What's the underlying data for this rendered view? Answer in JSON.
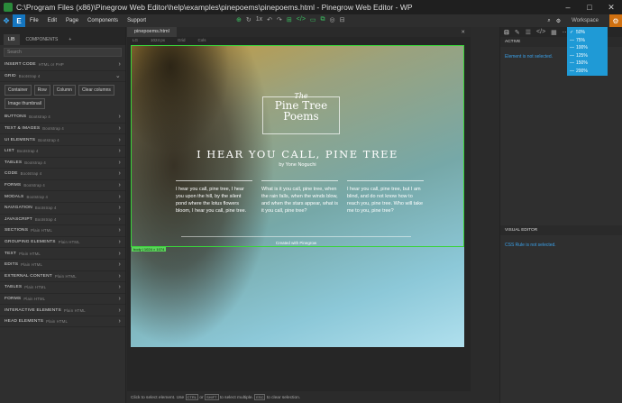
{
  "window": {
    "title": "C:\\Program Files (x86)\\Pinegrow Web Editor\\help\\examples\\pinepoems\\pinepoems.html - Pinegrow Web Editor - WP",
    "minimize": "–",
    "maximize": "□",
    "close": "✕"
  },
  "menubar": {
    "items": [
      "File",
      "Edit",
      "Page",
      "Components",
      "Support"
    ],
    "zoom_value": "1x",
    "workspace_label": "Workspace"
  },
  "left_panel": {
    "tabs": [
      "LIB",
      "COMPONENTS"
    ],
    "search_placeholder": "Search",
    "categories_top": [
      {
        "name": "INSERT CODE",
        "sub": "HTML or PHP"
      },
      {
        "name": "GRID",
        "sub": "Bootstrap 4"
      }
    ],
    "grid_buttons": [
      "Container",
      "Row",
      "Column",
      "Clear columns",
      "Image thumbnail"
    ],
    "categories": [
      {
        "name": "BUTTONS",
        "sub": "Bootstrap 4"
      },
      {
        "name": "TEXT & IMAGES",
        "sub": "Bootstrap 4"
      },
      {
        "name": "UI ELEMENTS",
        "sub": "Bootstrap 4"
      },
      {
        "name": "LIST",
        "sub": "Bootstrap 4"
      },
      {
        "name": "TABLES",
        "sub": "Bootstrap 4"
      },
      {
        "name": "CODE",
        "sub": "Bootstrap 4"
      },
      {
        "name": "FORMS",
        "sub": "Bootstrap 4"
      },
      {
        "name": "MODALS",
        "sub": "Bootstrap 4"
      },
      {
        "name": "NAVIGATION",
        "sub": "Bootstrap 4"
      },
      {
        "name": "JAVASCRIPT",
        "sub": "Bootstrap 4"
      },
      {
        "name": "SECTIONS",
        "sub": "Plain HTML"
      },
      {
        "name": "GROUPING ELEMENTS",
        "sub": "Plain HTML"
      },
      {
        "name": "TEXT",
        "sub": "Plain HTML"
      },
      {
        "name": "EDITS",
        "sub": "Plain HTML"
      },
      {
        "name": "EXTERNAL CONTENT",
        "sub": "Plain HTML"
      },
      {
        "name": "TABLES",
        "sub": "Plain HTML"
      },
      {
        "name": "FORMS",
        "sub": "Plain HTML"
      },
      {
        "name": "INTERACTIVE ELEMENTS",
        "sub": "Plain HTML"
      },
      {
        "name": "HEAD ELEMENTS",
        "sub": "Plain HTML"
      }
    ]
  },
  "document": {
    "tab_label": "pinepoems.html",
    "bar_items": [
      "LG",
      "1024 px",
      "Grid",
      "Cols"
    ],
    "selection_info": "body | 1024 × 1074"
  },
  "page": {
    "logo_the": "The",
    "logo_line1": "Pine Tree",
    "logo_line2": "Poems",
    "heading": "I HEAR YOU CALL, PINE TREE",
    "byline": "by Yone Noguchi",
    "columns": [
      "I hear you call, pine tree, I hear you upon the hill, by the silent pond where the lotus flowers bloom, I hear you call, pine tree.",
      "What is it you call, pine tree, when the rain falls, when the winds blow, and when the stars appear, what is it you call, pine tree?",
      "I hear you call, pine tree, but I am blind, and do not know how to reach you, pine tree. Who will take me to you, pine tree?"
    ],
    "footer": "Created with Pinegrow"
  },
  "right_panel": {
    "active_label": "ACTIVE",
    "element_msg": "Element is not selected.",
    "visual_editor_label": "VISUAL EDITOR",
    "css_msg": "CSS Rule is not selected."
  },
  "zoom_dropdown": {
    "options": [
      "50%",
      "75%",
      "100%",
      "125%",
      "150%",
      "200%"
    ],
    "selected_index": 0
  },
  "statusbar": {
    "text1": "Click to select element. Use",
    "key1": "CTRL",
    "text2": "or",
    "key2": "SHIFT",
    "text3": "to select multiple.",
    "key3": "ESC",
    "text4": "to clear selection."
  },
  "colors": {
    "accent": "#1f9ad6",
    "selection": "#3ad43a",
    "workspace_icon": "#d07010"
  }
}
